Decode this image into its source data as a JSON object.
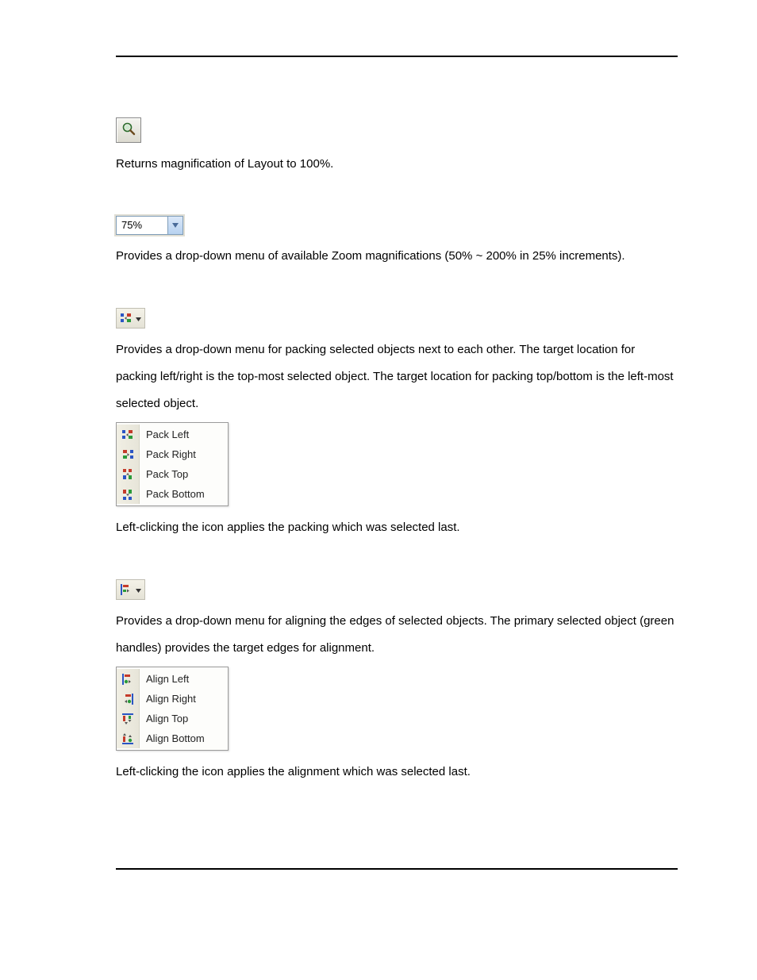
{
  "sections": {
    "zoom100": {
      "text": "Returns magnification of Layout to 100%."
    },
    "zoomCombo": {
      "value": "75%",
      "text": "Provides a drop-down menu of available Zoom magnifications (50% ~ 200% in 25% increments)."
    },
    "pack": {
      "intro": "Provides a drop-down menu for packing selected objects next to each other. The target location for packing left/right is the top-most selected object. The target location for packing top/bottom is the left-most selected object.",
      "menu": [
        "Pack Left",
        "Pack Right",
        "Pack Top",
        "Pack Bottom"
      ],
      "footer": "Left-clicking the icon applies the packing which was selected last."
    },
    "align": {
      "intro": "Provides a drop-down menu for aligning the edges of selected objects. The primary selected object (green handles) provides the target edges for alignment.",
      "menu": [
        "Align Left",
        "Align Right",
        "Align Top",
        "Align Bottom"
      ],
      "footer": "Left-clicking the icon applies the alignment which was selected last."
    }
  }
}
